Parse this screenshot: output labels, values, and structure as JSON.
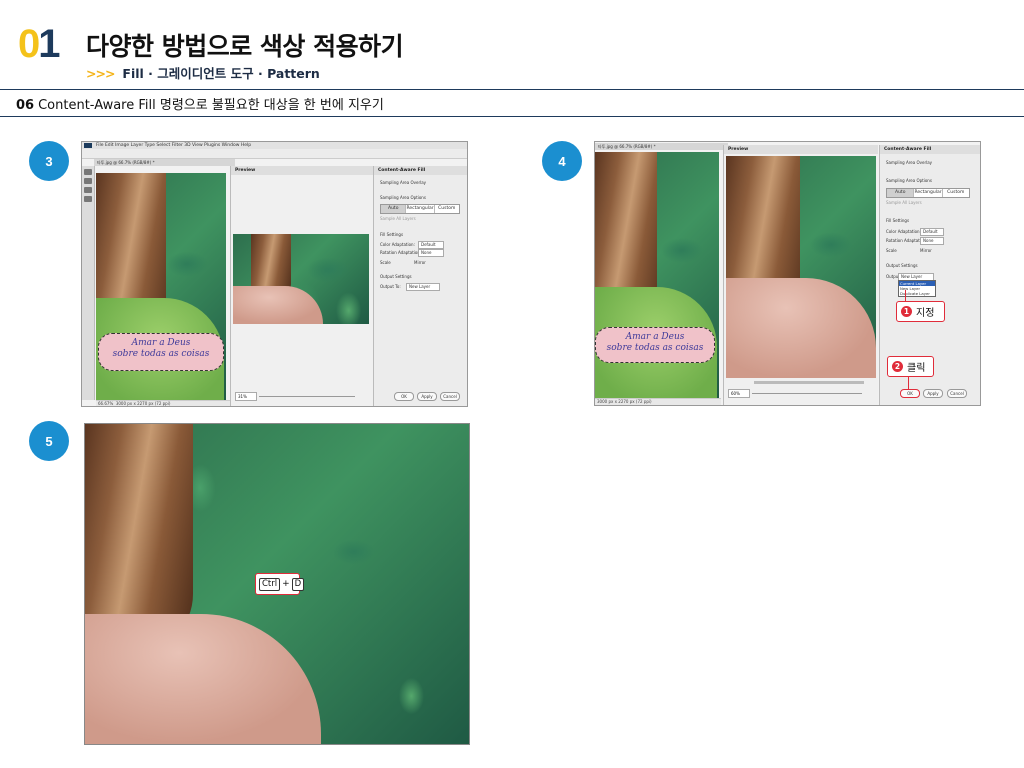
{
  "header": {
    "chapter_num_first": "0",
    "chapter_num_second": "1",
    "title": "다양한 방법으로 색상 적용하기",
    "sub_arrows": ">>>",
    "subtitle": "Fill · 그레이디언트 도구 · Pattern"
  },
  "section": {
    "number": "06",
    "title": "Content-Aware Fill 명령으로 불필요한 대상을 한 번에 지우기"
  },
  "steps": [
    "3",
    "4",
    "5"
  ],
  "shot3": {
    "menu": "File  Edit  Image  Layer  Type  Select  Filter  3D  View  Plugins  Window  Help",
    "doc_tab": "타투.jpg @ 66.7% (RGB/8#) *",
    "preview_label": "Preview",
    "panel_title": "Content-Aware Fill",
    "sampling_overlay": "Sampling Area Overlay",
    "sampling_options": "Sampling Area Options",
    "seg": [
      "Auto",
      "Rectangular",
      "Custom"
    ],
    "sample_all_layers": "Sample All Layers",
    "fill_settings": "Fill Settings",
    "color_adaptation_label": "Color Adaptation:",
    "color_adaptation_value": "Default",
    "rotation_adaptation_label": "Rotation Adaptation:",
    "rotation_adaptation_value": "None",
    "scale": "Scale",
    "mirror": "Mirror",
    "output_settings": "Output Settings",
    "output_to_label": "Output To:",
    "output_to_value": "New Layer",
    "zoom": "31%",
    "status_zoom": "66.67%",
    "status_dims": "3000 px x 2270 px (72 ppi)",
    "ok": "OK",
    "apply": "Apply",
    "cancel": "Cancel",
    "tattoo_line1": "Amar a  Deus",
    "tattoo_line2": "sobre todas as coisas"
  },
  "shot4": {
    "doc_tab": "타투.jpg @ 66.7% (RGB/8#) *",
    "preview_label": "Preview",
    "panel_title": "Content-Aware Fill",
    "sampling_overlay": "Sampling Area Overlay",
    "sampling_options": "Sampling Area Options",
    "seg": [
      "Auto",
      "Rectangular",
      "Custom"
    ],
    "sample_all_layers": "Sample All Layers",
    "fill_settings": "Fill Settings",
    "color_adaptation_label": "Color Adaptation:",
    "color_adaptation_value": "Default",
    "rotation_adaptation_label": "Rotation Adaptation:",
    "rotation_adaptation_value": "None",
    "scale": "Scale",
    "mirror": "Mirror",
    "output_settings": "Output Settings",
    "output_to_label": "Output To:",
    "output_to_value": "New Layer",
    "dropdown_options": [
      "Current Layer",
      "New Layer",
      "Duplicate Layer"
    ],
    "zoom": "60%",
    "status_dims": "3000 px x 2270 px (72 ppi)",
    "ok": "OK",
    "apply": "Apply",
    "cancel": "Cancel",
    "callout1_num": "1",
    "callout1_text": "지정",
    "callout2_num": "2",
    "callout2_text": "클릭",
    "tattoo_line1": "Amar a  Deus",
    "tattoo_line2": "sobre todas as coisas"
  },
  "shot5": {
    "key1": "Ctrl",
    "plus": "+",
    "key2": "D"
  },
  "colors": {
    "accent_blue": "#1b8fd0",
    "callout_red": "#e02c3a",
    "chapter_yellow": "#f4c21a",
    "chapter_navy": "#1d3a5c"
  }
}
